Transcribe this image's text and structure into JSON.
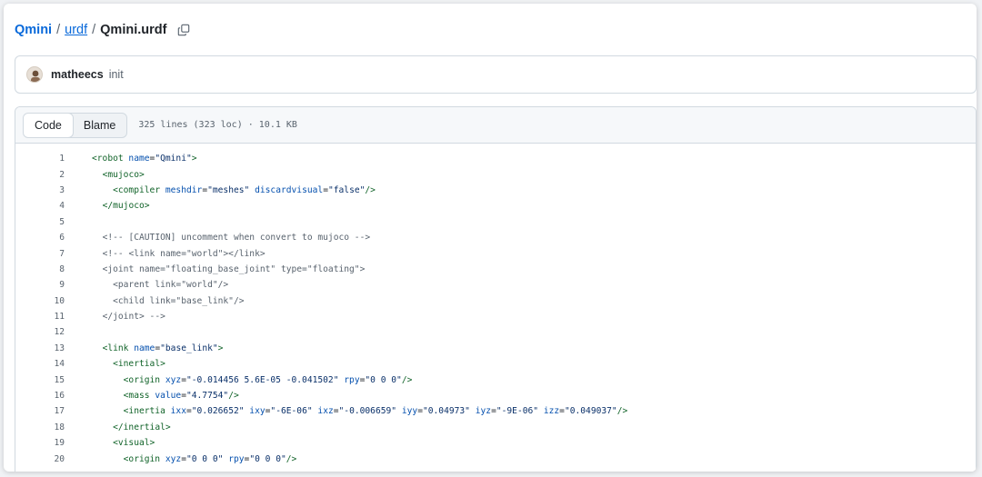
{
  "breadcrumb": {
    "repo": "Qmini",
    "sep1": "/",
    "dir": "urdf",
    "sep2": "/",
    "file": "Qmini.urdf"
  },
  "icons": {
    "copy": "copy-icon",
    "avatar": "user-avatar-icon"
  },
  "commit": {
    "author": "matheecs",
    "message": "init"
  },
  "file_view": {
    "tabs": [
      {
        "label": "Code",
        "active": true
      },
      {
        "label": "Blame",
        "active": false
      }
    ],
    "info": "325 lines (323 loc) · 10.1 KB"
  },
  "code_lines": [
    {
      "num": "1",
      "indent": 0,
      "parts": [
        {
          "t": "tag",
          "v": "<robot"
        },
        {
          "t": "attr",
          "v": " name"
        },
        {
          "t": "plain",
          "v": "="
        },
        {
          "t": "str",
          "v": "\"Qmini\""
        },
        {
          "t": "tag",
          "v": ">"
        }
      ]
    },
    {
      "num": "2",
      "indent": 2,
      "parts": [
        {
          "t": "tag",
          "v": "<mujoco>"
        }
      ]
    },
    {
      "num": "3",
      "indent": 4,
      "parts": [
        {
          "t": "tag",
          "v": "<compiler"
        },
        {
          "t": "attr",
          "v": " meshdir"
        },
        {
          "t": "plain",
          "v": "="
        },
        {
          "t": "str",
          "v": "\"meshes\""
        },
        {
          "t": "attr",
          "v": " discardvisual"
        },
        {
          "t": "plain",
          "v": "="
        },
        {
          "t": "str",
          "v": "\"false\""
        },
        {
          "t": "tag",
          "v": "/>"
        }
      ]
    },
    {
      "num": "4",
      "indent": 2,
      "parts": [
        {
          "t": "tag",
          "v": "</mujoco>"
        }
      ]
    },
    {
      "num": "5",
      "indent": 0,
      "parts": []
    },
    {
      "num": "6",
      "indent": 2,
      "parts": [
        {
          "t": "cmt",
          "v": "<!-- [CAUTION] uncomment when convert to mujoco -->"
        }
      ]
    },
    {
      "num": "7",
      "indent": 2,
      "parts": [
        {
          "t": "cmt",
          "v": "<!-- <link name=\"world\"></link>"
        }
      ]
    },
    {
      "num": "8",
      "indent": 2,
      "parts": [
        {
          "t": "cmt",
          "v": "<joint name=\"floating_base_joint\" type=\"floating\">"
        }
      ]
    },
    {
      "num": "9",
      "indent": 4,
      "parts": [
        {
          "t": "cmt",
          "v": "<parent link=\"world\"/>"
        }
      ]
    },
    {
      "num": "10",
      "indent": 4,
      "parts": [
        {
          "t": "cmt",
          "v": "<child link=\"base_link\"/>"
        }
      ]
    },
    {
      "num": "11",
      "indent": 2,
      "parts": [
        {
          "t": "cmt",
          "v": "</joint> -->"
        }
      ]
    },
    {
      "num": "12",
      "indent": 0,
      "parts": []
    },
    {
      "num": "13",
      "indent": 2,
      "parts": [
        {
          "t": "tag",
          "v": "<link"
        },
        {
          "t": "attr",
          "v": " name"
        },
        {
          "t": "plain",
          "v": "="
        },
        {
          "t": "str",
          "v": "\"base_link\""
        },
        {
          "t": "tag",
          "v": ">"
        }
      ]
    },
    {
      "num": "14",
      "indent": 4,
      "parts": [
        {
          "t": "tag",
          "v": "<inertial>"
        }
      ]
    },
    {
      "num": "15",
      "indent": 6,
      "parts": [
        {
          "t": "tag",
          "v": "<origin"
        },
        {
          "t": "attr",
          "v": " xyz"
        },
        {
          "t": "plain",
          "v": "="
        },
        {
          "t": "str",
          "v": "\"-0.014456 5.6E-05 -0.041502\""
        },
        {
          "t": "attr",
          "v": " rpy"
        },
        {
          "t": "plain",
          "v": "="
        },
        {
          "t": "str",
          "v": "\"0 0 0\""
        },
        {
          "t": "tag",
          "v": "/>"
        }
      ]
    },
    {
      "num": "16",
      "indent": 6,
      "parts": [
        {
          "t": "tag",
          "v": "<mass"
        },
        {
          "t": "attr",
          "v": " value"
        },
        {
          "t": "plain",
          "v": "="
        },
        {
          "t": "str",
          "v": "\"4.7754\""
        },
        {
          "t": "tag",
          "v": "/>"
        }
      ]
    },
    {
      "num": "17",
      "indent": 6,
      "parts": [
        {
          "t": "tag",
          "v": "<inertia"
        },
        {
          "t": "attr",
          "v": " ixx"
        },
        {
          "t": "plain",
          "v": "="
        },
        {
          "t": "str",
          "v": "\"0.026652\""
        },
        {
          "t": "attr",
          "v": " ixy"
        },
        {
          "t": "plain",
          "v": "="
        },
        {
          "t": "str",
          "v": "\"-6E-06\""
        },
        {
          "t": "attr",
          "v": " ixz"
        },
        {
          "t": "plain",
          "v": "="
        },
        {
          "t": "str",
          "v": "\"-0.006659\""
        },
        {
          "t": "attr",
          "v": " iyy"
        },
        {
          "t": "plain",
          "v": "="
        },
        {
          "t": "str",
          "v": "\"0.04973\""
        },
        {
          "t": "attr",
          "v": " iyz"
        },
        {
          "t": "plain",
          "v": "="
        },
        {
          "t": "str",
          "v": "\"-9E-06\""
        },
        {
          "t": "attr",
          "v": " izz"
        },
        {
          "t": "plain",
          "v": "="
        },
        {
          "t": "str",
          "v": "\"0.049037\""
        },
        {
          "t": "tag",
          "v": "/>"
        }
      ]
    },
    {
      "num": "18",
      "indent": 4,
      "parts": [
        {
          "t": "tag",
          "v": "</inertial>"
        }
      ]
    },
    {
      "num": "19",
      "indent": 4,
      "parts": [
        {
          "t": "tag",
          "v": "<visual>"
        }
      ]
    },
    {
      "num": "20",
      "indent": 6,
      "parts": [
        {
          "t": "tag",
          "v": "<origin"
        },
        {
          "t": "attr",
          "v": " xyz"
        },
        {
          "t": "plain",
          "v": "="
        },
        {
          "t": "str",
          "v": "\"0 0 0\""
        },
        {
          "t": "attr",
          "v": " rpy"
        },
        {
          "t": "plain",
          "v": "="
        },
        {
          "t": "str",
          "v": "\"0 0 0\""
        },
        {
          "t": "tag",
          "v": "/>"
        }
      ]
    }
  ]
}
